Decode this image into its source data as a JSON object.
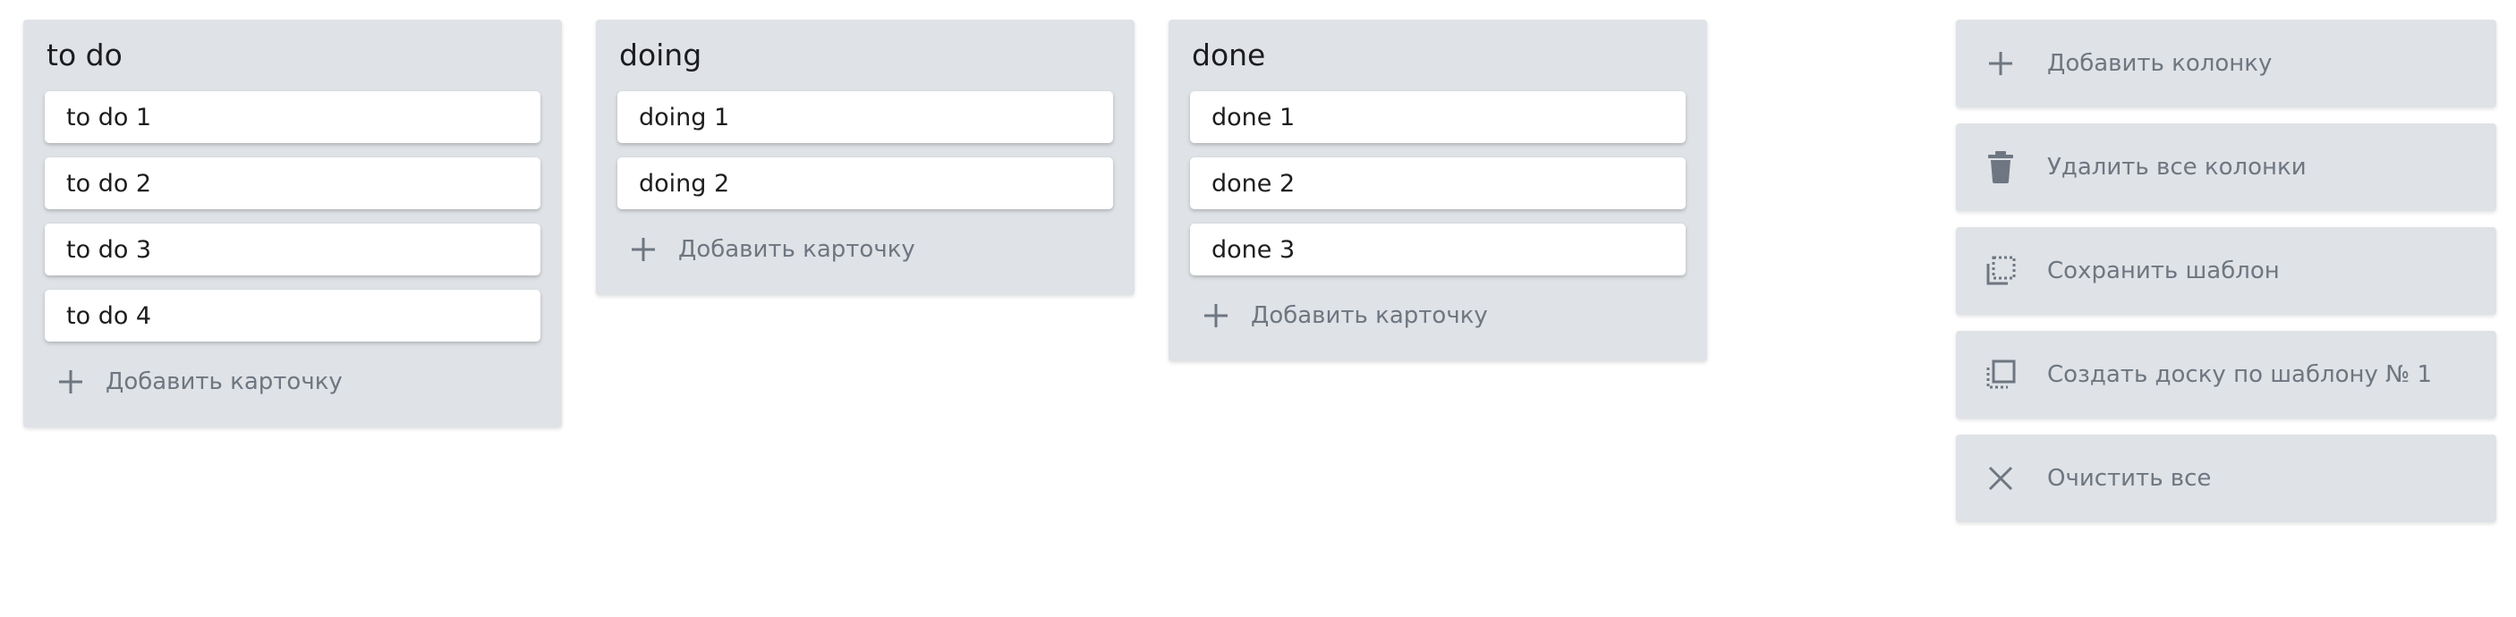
{
  "colors": {
    "column_bg": "#dfe2e6",
    "card_bg": "#ffffff",
    "muted_text": "#6e7681",
    "title_text": "#1d1d1f"
  },
  "columns": [
    {
      "title": "to do",
      "cards": [
        "to do 1",
        "to do 2",
        "to do 3",
        "to do 4"
      ],
      "add_card_label": "Добавить карточку"
    },
    {
      "title": "doing",
      "cards": [
        "doing 1",
        "doing 2"
      ],
      "add_card_label": "Добавить карточку"
    },
    {
      "title": "done",
      "cards": [
        "done 1",
        "done 2",
        "done 3"
      ],
      "add_card_label": "Добавить карточку"
    }
  ],
  "actions": [
    {
      "label": "Добавить колонку",
      "icon": "plus-icon"
    },
    {
      "label": "Удалить все колонки",
      "icon": "trash-icon"
    },
    {
      "label": "Сохранить шаблон",
      "icon": "save-template-icon"
    },
    {
      "label": "Создать доску по шаблону № 1",
      "icon": "create-from-template-icon"
    },
    {
      "label": "Очистить все",
      "icon": "close-icon"
    }
  ]
}
